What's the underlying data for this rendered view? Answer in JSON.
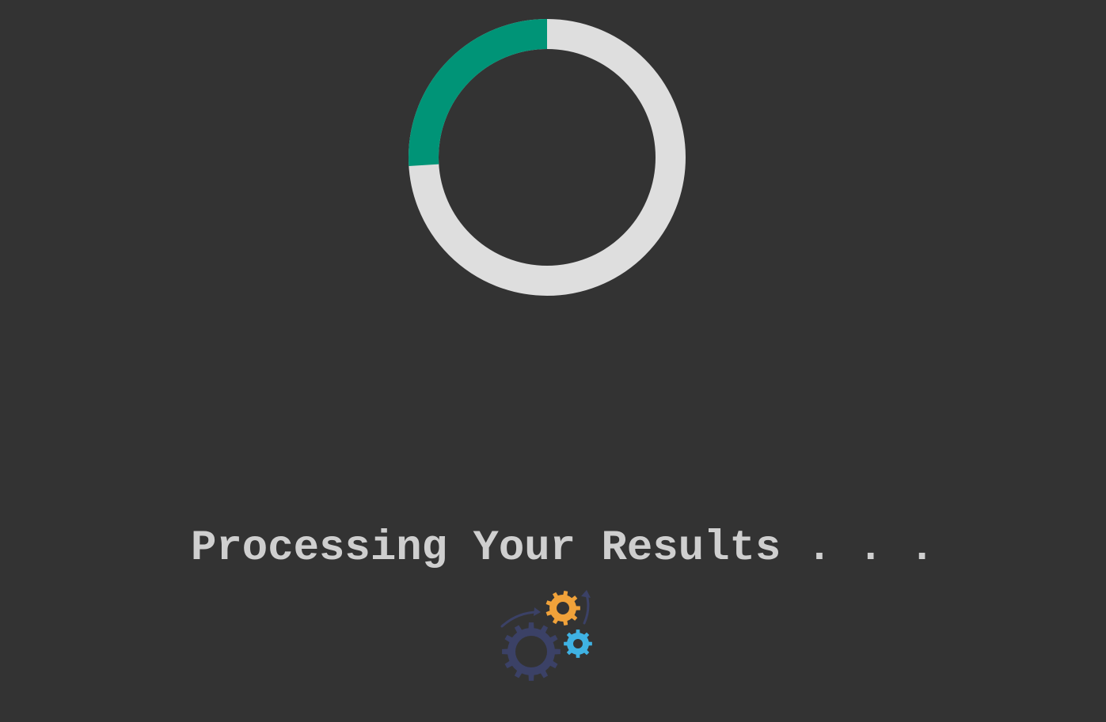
{
  "status": {
    "message": "Processing Your Results . . .",
    "progress_fraction": 0.26
  },
  "spinner": {
    "track_color": "#dedede",
    "arc_color": "#009477"
  },
  "icons": {
    "gears": "gears-icon",
    "gear_large_color": "#3b4166",
    "gear_orange_color": "#f0a23a",
    "gear_blue_color": "#3fb2e3"
  },
  "colors": {
    "background": "#333333",
    "text": "#cfcfcf"
  }
}
